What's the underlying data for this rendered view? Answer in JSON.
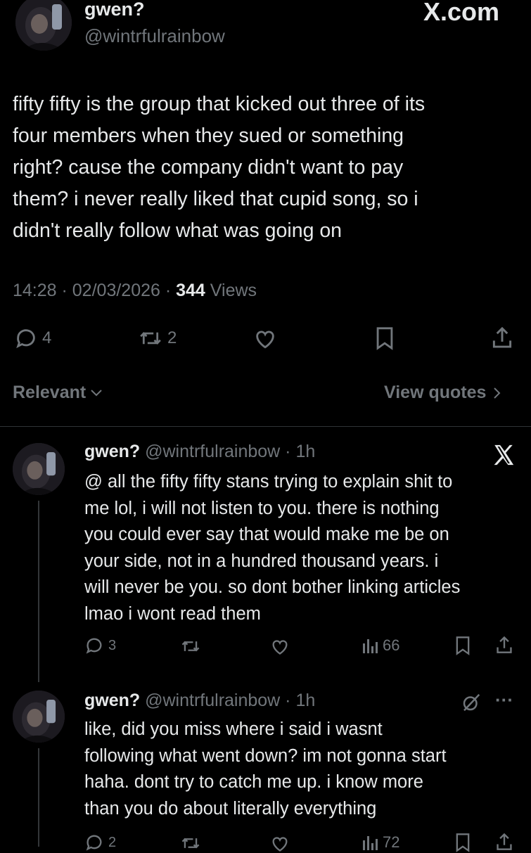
{
  "header": {
    "site_logo": "X.com"
  },
  "main_post": {
    "display_name": "gwen?",
    "handle": "@wintrfulrainbow",
    "text_lines": [
      "fifty fifty is the group that kicked out three of its",
      "four members when they sued or something",
      "right? cause the company didn't want to pay",
      "them? i never really liked that cupid song, so i",
      "didn't really follow what was going on"
    ],
    "time": "14:28",
    "date": "02/03/2026",
    "views_count": "344",
    "views_label": "Views",
    "reply_count": "4",
    "repost_count": "2",
    "icons": [
      "reply-icon",
      "repost-icon",
      "like-icon",
      "bookmark-icon",
      "share-icon"
    ]
  },
  "filter_bar": {
    "sort_label": "Relevant",
    "quotes_label": "View quotes"
  },
  "replies": [
    {
      "display_name": "gwen?",
      "meta": "@wintrfulrainbow · 1h",
      "corner_icon": "x-logo-icon",
      "text_lines": [
        "@ all the fifty fifty stans trying to explain shit to",
        "me lol, i will not listen to you. there is nothing",
        "you could ever say that would make me be on",
        "your side, not in a hundred thousand years. i",
        "will never be you. so dont bother linking articles",
        "lmao i wont read them"
      ],
      "reply_count": "3",
      "repost_count": "",
      "views_count": "66"
    },
    {
      "display_name": "gwen?",
      "meta": "@wintrfulrainbow · 1h",
      "corner_icon": "grok-icon",
      "more_label": "···",
      "text_lines": [
        "like, did you miss where i said i wasnt",
        "following what went down? im not gonna start",
        "haha. dont try to catch me up. i know more",
        "than you do about literally everything"
      ],
      "reply_count": "2",
      "views_count": "72"
    }
  ],
  "colors": {
    "background": "#000000",
    "text": "#e7e9ea",
    "muted": "#71767b",
    "divider": "#2f3336"
  }
}
